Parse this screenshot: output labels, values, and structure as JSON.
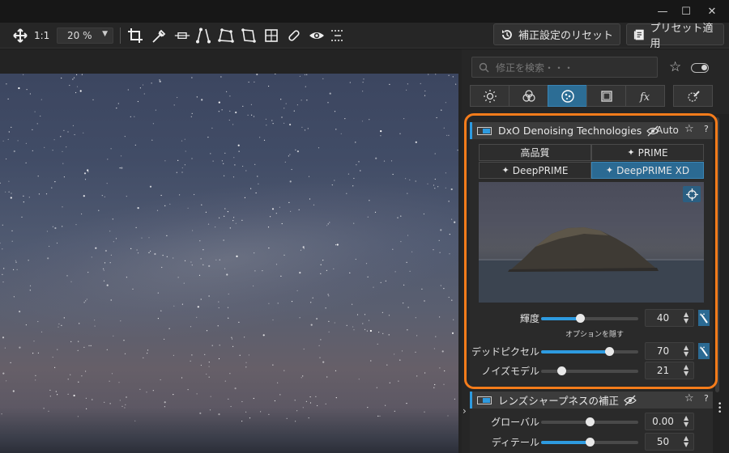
{
  "window": {
    "minimize": "—",
    "maximize": "☐",
    "close": "✕"
  },
  "toolbar": {
    "zoom_1to1": "1:1",
    "zoom_value": "20 %",
    "reset_label": "補正設定のリセット",
    "preset_label": "プリセット適用"
  },
  "panel": {
    "search_placeholder": "修正を検索・・・",
    "denoise": {
      "title": "DxO Denoising Technologies",
      "auto": "Auto",
      "help": "?",
      "modes": [
        "高品質",
        "PRIME",
        "DeepPRIME",
        "DeepPRIME XD"
      ],
      "active_mode": "DeepPRIME XD",
      "sliders": [
        {
          "label": "輝度",
          "value": "40",
          "fraction": 0.4,
          "wand": true
        },
        {
          "label": "デッドピクセル",
          "value": "70",
          "fraction": 0.7,
          "wand": true
        },
        {
          "label": "ノイズモデル",
          "value": "21",
          "fraction": 0.21,
          "wand": false,
          "bipolar": true
        }
      ],
      "hide_options": "オプションを隠す"
    },
    "lens_sharpness": {
      "title": "レンズシャープネスの補正",
      "help": "?",
      "sliders": [
        {
          "label": "グローバル",
          "value": "0.00",
          "fraction": 0.5
        },
        {
          "label": "ディテール",
          "value": "50",
          "fraction": 0.5
        }
      ]
    }
  },
  "colors": {
    "accent": "#2e9be0",
    "active_tab": "#2c6d95",
    "highlight": "#f57c1b"
  }
}
